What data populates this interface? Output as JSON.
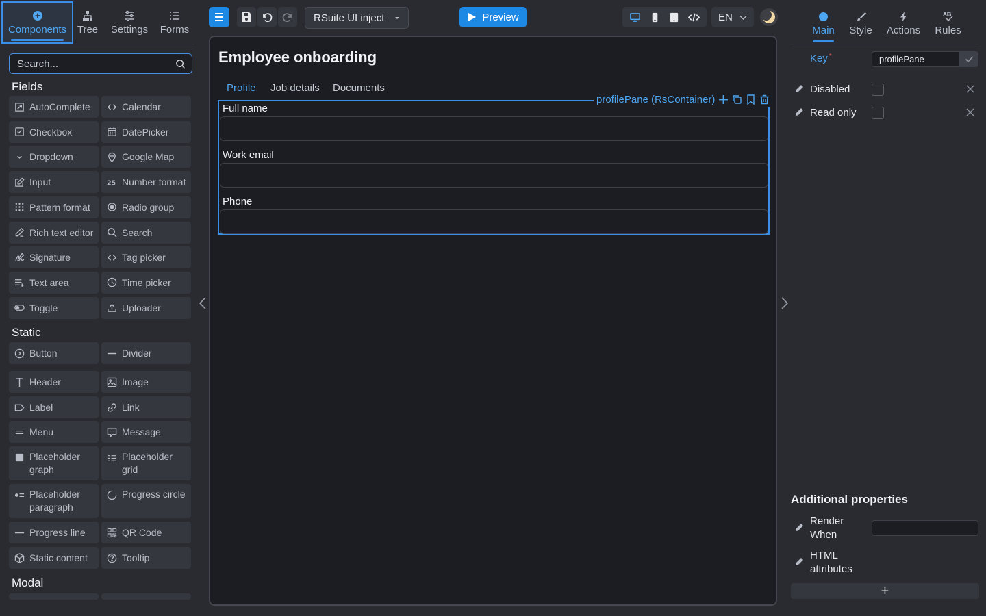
{
  "left_tabs": [
    {
      "label": "Components",
      "icon": "plus-circle-icon"
    },
    {
      "label": "Tree",
      "icon": "tree-icon"
    },
    {
      "label": "Settings",
      "icon": "sliders-icon"
    },
    {
      "label": "Forms",
      "icon": "list-icon"
    }
  ],
  "search": {
    "placeholder": "Search..."
  },
  "sections": {
    "fields": "Fields",
    "static": "Static",
    "modal": "Modal"
  },
  "fields": [
    {
      "label": "AutoComplete",
      "icon": "autocomplete-icon"
    },
    {
      "label": "Calendar",
      "icon": "code-brackets-icon"
    },
    {
      "label": "Checkbox",
      "icon": "checkbox-icon"
    },
    {
      "label": "DatePicker",
      "icon": "calendar-icon"
    },
    {
      "label": "Dropdown",
      "icon": "chevron-down-icon"
    },
    {
      "label": "Google Map",
      "icon": "map-pin-icon"
    },
    {
      "label": "Input",
      "icon": "edit-icon"
    },
    {
      "label": "Number format",
      "icon": "number-icon"
    },
    {
      "label": "Pattern format",
      "icon": "pattern-grid-icon"
    },
    {
      "label": "Radio group",
      "icon": "radio-icon"
    },
    {
      "label": "Rich text editor",
      "icon": "pen-icon"
    },
    {
      "label": "Search",
      "icon": "search-icon"
    },
    {
      "label": "Signature",
      "icon": "signature-icon"
    },
    {
      "label": "Tag picker",
      "icon": "code-brackets-icon"
    },
    {
      "label": "Text area",
      "icon": "text-area-icon"
    },
    {
      "label": "Time picker",
      "icon": "clock-icon"
    },
    {
      "label": "Toggle",
      "icon": "toggle-icon"
    },
    {
      "label": "Uploader",
      "icon": "upload-icon"
    }
  ],
  "static": [
    {
      "label": "Button",
      "icon": "button-icon"
    },
    {
      "label": "Divider",
      "icon": "divider-icon"
    },
    {
      "label": "Header",
      "icon": "header-icon"
    },
    {
      "label": "Image",
      "icon": "image-icon"
    },
    {
      "label": "Label",
      "icon": "label-icon"
    },
    {
      "label": "Link",
      "icon": "link-icon"
    },
    {
      "label": "Menu",
      "icon": "menu-icon"
    },
    {
      "label": "Message",
      "icon": "message-icon"
    },
    {
      "label": "Placeholder graph",
      "icon": "placeholder-graph-icon"
    },
    {
      "label": "Placeholder grid",
      "icon": "placeholder-grid-icon"
    },
    {
      "label": "Placeholder paragraph",
      "icon": "placeholder-paragraph-icon"
    },
    {
      "label": "Progress circle",
      "icon": "progress-circle-icon"
    },
    {
      "label": "Progress line",
      "icon": "progress-line-icon"
    },
    {
      "label": "QR Code",
      "icon": "qr-code-icon"
    },
    {
      "label": "Static content",
      "icon": "cube-icon"
    },
    {
      "label": "Tooltip",
      "icon": "help-circle-icon"
    }
  ],
  "toolbar": {
    "form_name": "RSuite UI inject",
    "preview_label": "Preview",
    "language": "EN"
  },
  "canvas": {
    "title": "Employee onboarding",
    "tabs": [
      "Profile",
      "Job details",
      "Documents"
    ],
    "container_label": "profilePane (RsContainer)",
    "fields": [
      {
        "label": "Full name",
        "value": ""
      },
      {
        "label": "Work email",
        "value": ""
      },
      {
        "label": "Phone",
        "value": ""
      }
    ]
  },
  "right_tabs": [
    {
      "label": "Main",
      "icon": "circle-icon"
    },
    {
      "label": "Style",
      "icon": "brush-icon"
    },
    {
      "label": "Actions",
      "icon": "lightning-icon"
    },
    {
      "label": "Rules",
      "icon": "rules-icon"
    }
  ],
  "props": {
    "key_label": "Key",
    "key_required_mark": "*",
    "key_value": "profilePane",
    "disabled_label": "Disabled",
    "read_only_label": "Read only",
    "additional_title": "Additional properties",
    "render_when_label": "Render When",
    "html_attributes_label": "HTML attributes",
    "render_when_value": "",
    "add_label": "+"
  },
  "colors": {
    "accent": "#3a8ee6",
    "primary_button": "#1e88e5",
    "panel": "#292b31",
    "canvas": "#1b1d22"
  }
}
